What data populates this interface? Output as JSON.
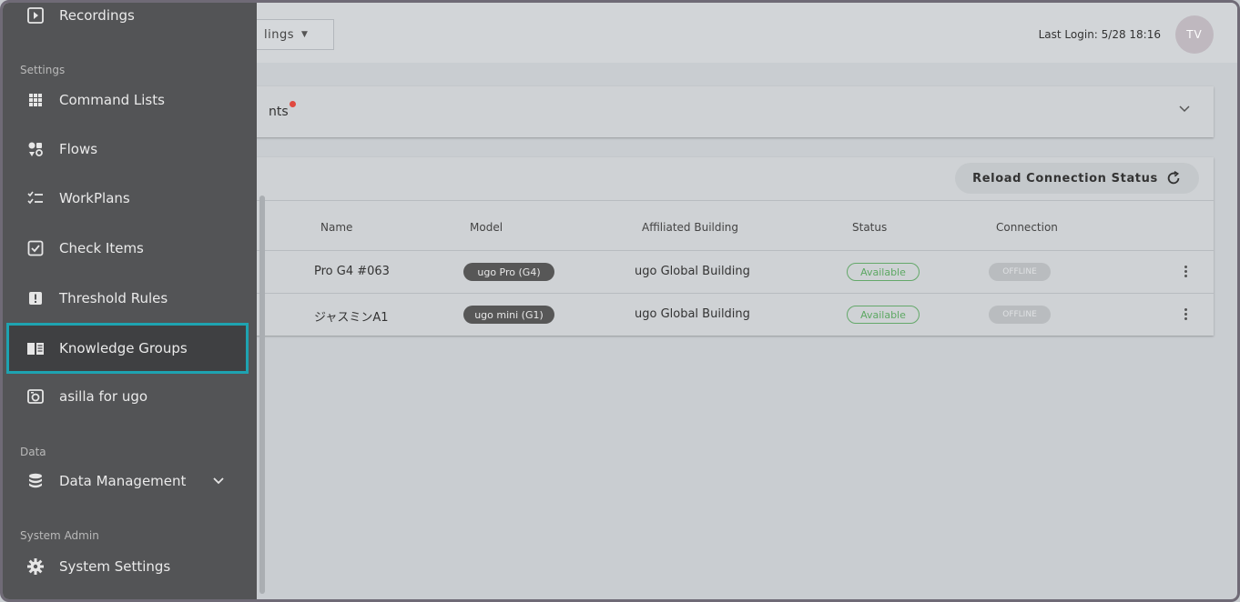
{
  "header": {
    "dropdown_label": "lings",
    "last_login": "Last Login: 5/28 18:16",
    "avatar_initials": "TV"
  },
  "panel_collapsed": {
    "label": "nts"
  },
  "robot_panel": {
    "reload_label": "Reload Connection Status",
    "columns": [
      "Name",
      "Model",
      "Affiliated Building",
      "Status",
      "Connection"
    ],
    "rows": [
      {
        "name": "Pro G4 #063",
        "model": "ugo Pro (G4)",
        "building": "ugo Global Building",
        "status": "Available",
        "connection": "OFFLINE"
      },
      {
        "name": "ジャスミンA1",
        "model": "ugo mini (G1)",
        "building": "ugo Global Building",
        "status": "Available",
        "connection": "OFFLINE"
      }
    ]
  },
  "sidebar": {
    "top_item": "Recordings",
    "section_settings": "Settings",
    "settings_items": [
      {
        "label": "Command Lists",
        "icon": "grid-icon"
      },
      {
        "label": "Flows",
        "icon": "flows-icon"
      },
      {
        "label": "WorkPlans",
        "icon": "checklist-icon"
      },
      {
        "label": "Check Items",
        "icon": "checkbox-icon"
      },
      {
        "label": "Threshold Rules",
        "icon": "alert-icon"
      },
      {
        "label": "Knowledge Groups",
        "icon": "book-icon"
      },
      {
        "label": "asilla for ugo",
        "icon": "camera-icon"
      }
    ],
    "section_data": "Data",
    "data_item": "Data Management",
    "section_admin": "System Admin",
    "admin_item": "System Settings"
  },
  "colors": {
    "sidebar_bg": "#535456",
    "active_border": "#1ea3b1",
    "status_green": "#5da863",
    "notification_dot": "#e0483f"
  }
}
